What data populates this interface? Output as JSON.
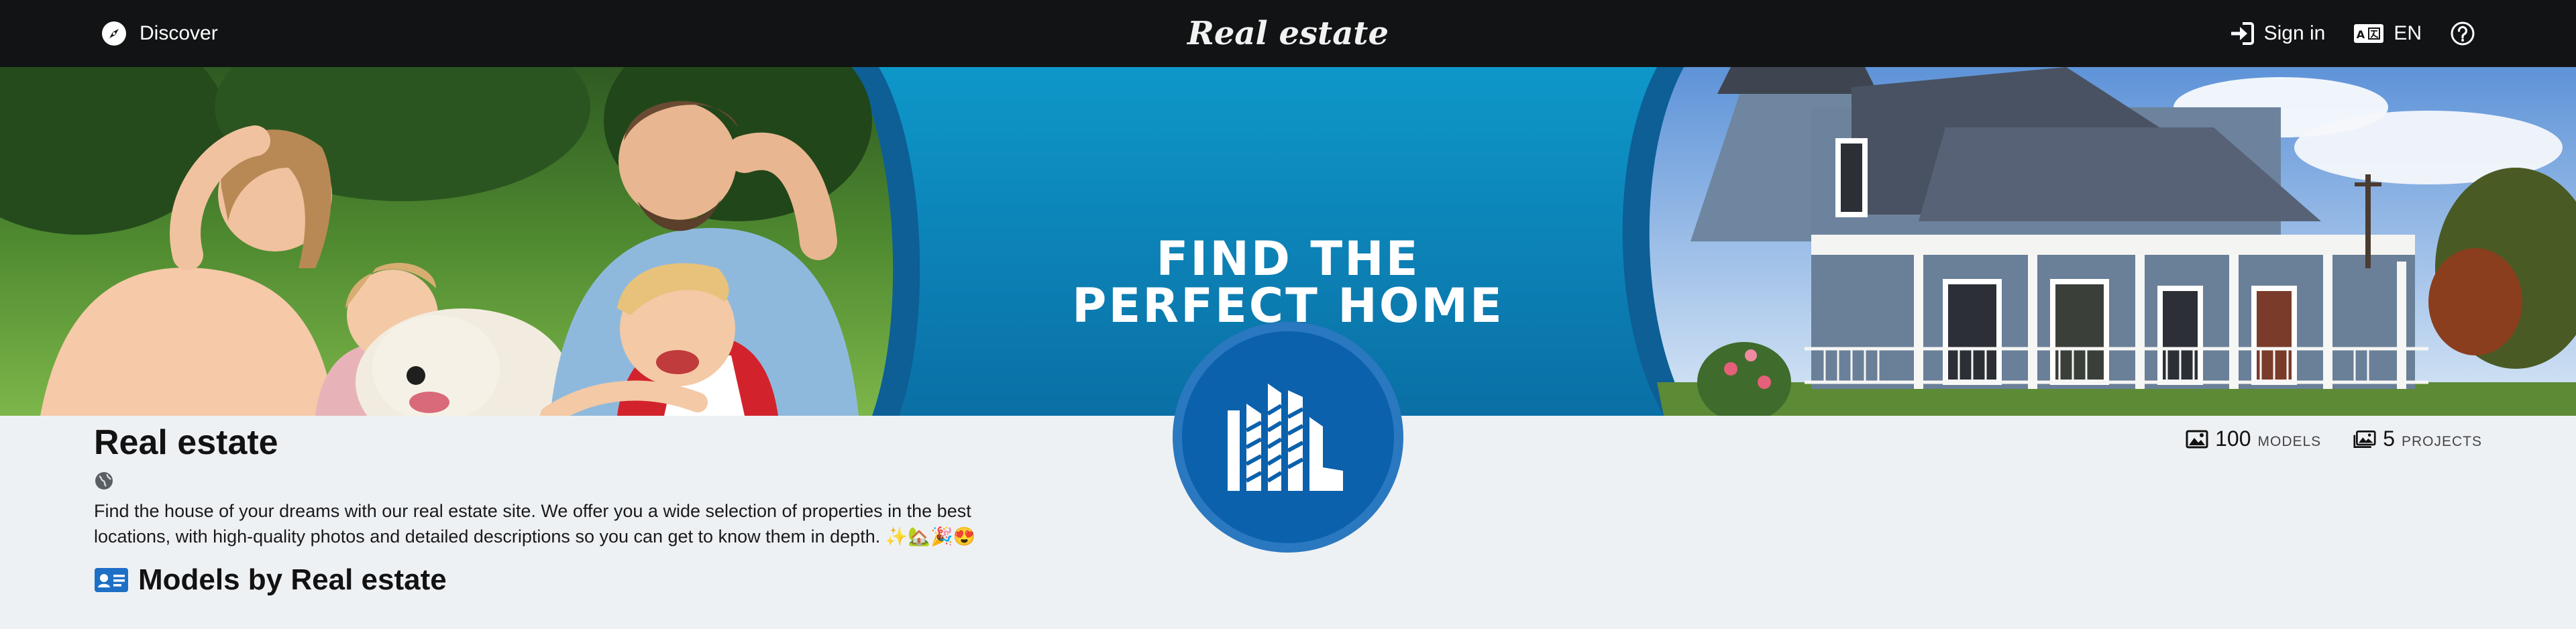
{
  "header": {
    "discover_label": "Discover",
    "brand": "Real estate",
    "sign_in_label": "Sign in",
    "language_label": "EN"
  },
  "banner": {
    "headline_line1": "FIND THE",
    "headline_line2": "PERFECT HOME"
  },
  "profile": {
    "name": "Real estate",
    "description": "Find the house of your dreams with our real estate site. We offer you a wide selection of properties in the best locations, with high-quality photos and detailed descriptions so you can get to know them in depth. ✨🏡🎉😍"
  },
  "stats": {
    "models_count": "100",
    "models_label": "MODELS",
    "projects_count": "5",
    "projects_label": "PROJECTS"
  },
  "section": {
    "models_heading": "Models by Real estate"
  },
  "colors": {
    "topbar": "#121314",
    "banner_blue": "#0a7fb5",
    "logo_blue": "#0b61ac",
    "page_bg": "#eef1f4"
  }
}
